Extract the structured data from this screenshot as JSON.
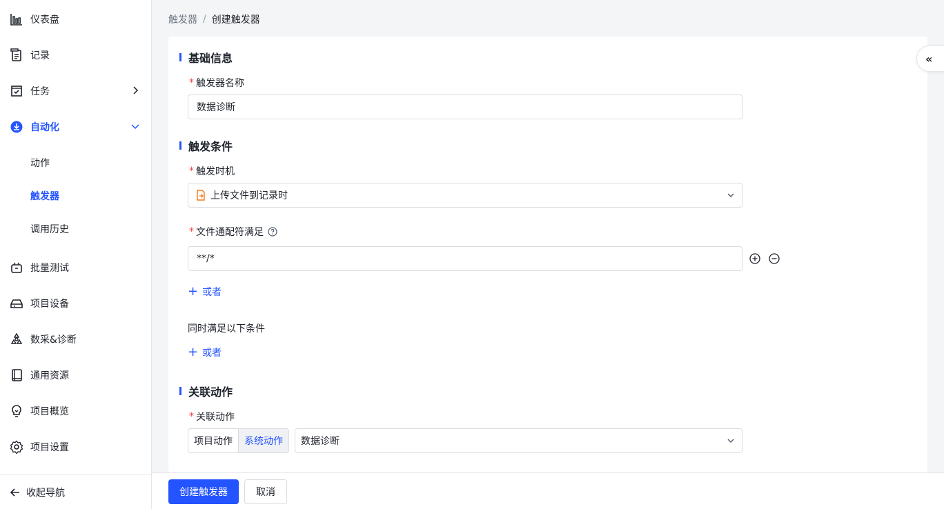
{
  "sidebar": {
    "items": [
      {
        "label": "仪表盘",
        "icon": "dashboard-icon"
      },
      {
        "label": "记录",
        "icon": "record-icon"
      },
      {
        "label": "任务",
        "icon": "task-icon"
      },
      {
        "label": "自动化",
        "icon": "automation-icon"
      },
      {
        "label": "批量测试",
        "icon": "batch-test-icon"
      },
      {
        "label": "项目设备",
        "icon": "device-icon"
      },
      {
        "label": "数采&诊断",
        "icon": "diagnosis-icon"
      },
      {
        "label": "通用资源",
        "icon": "resource-icon"
      },
      {
        "label": "项目概览",
        "icon": "overview-icon"
      },
      {
        "label": "项目设置",
        "icon": "settings-icon"
      }
    ],
    "sub_items": [
      "动作",
      "触发器",
      "调用历史"
    ],
    "collapse_label": "收起导航",
    "accent": "#2454ff"
  },
  "breadcrumb": {
    "parent": "触发器",
    "separator": "/",
    "current": "创建触发器"
  },
  "form": {
    "basic": {
      "title": "基础信息",
      "name_label": "触发器名称",
      "name_value": "数据诊断"
    },
    "condition": {
      "title": "触发条件",
      "timing_label": "触发时机",
      "timing_value": "上传文件到记录时",
      "wildcard_label": "文件通配符满足",
      "wildcard_value": "**/*",
      "or_label": "或者",
      "also_label": "同时满足以下条件",
      "or_label2": "或者"
    },
    "action": {
      "title": "关联动作",
      "label": "关联动作",
      "seg_options": [
        "项目动作",
        "系统动作"
      ],
      "selected_option": "系统动作",
      "action_value": "数据诊断"
    }
  },
  "footer": {
    "create_label": "创建触发器",
    "cancel_label": "取消"
  },
  "collapse_panel_glyph": "«"
}
